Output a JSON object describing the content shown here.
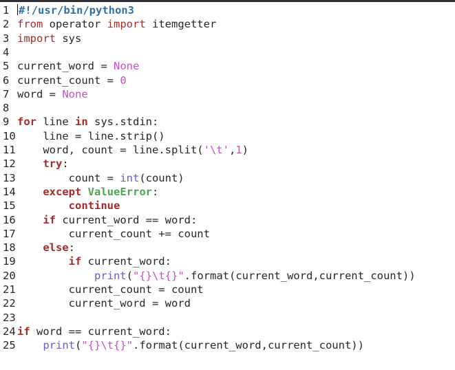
{
  "editor": {
    "language": "python",
    "colors": {
      "background": "#ffffff",
      "text": "#262626",
      "keyword": "#a52a2a",
      "builtin": "#6a5acd",
      "string": "#c451c4",
      "exception": "#4fa44f",
      "shebang": "#2f6fa8"
    },
    "lines": [
      {
        "n": "1",
        "tokens": [
          {
            "t": "#!/usr/bin/python3",
            "c": "sheb"
          }
        ]
      },
      {
        "n": "2",
        "tokens": [
          {
            "t": "from",
            "c": "kw2"
          },
          {
            "t": " operator ",
            "c": ""
          },
          {
            "t": "import",
            "c": "kw2"
          },
          {
            "t": " itemgetter",
            "c": ""
          }
        ]
      },
      {
        "n": "3",
        "tokens": [
          {
            "t": "import",
            "c": "kw2"
          },
          {
            "t": " sys",
            "c": ""
          }
        ]
      },
      {
        "n": "4",
        "tokens": []
      },
      {
        "n": "5",
        "tokens": [
          {
            "t": "current_word = ",
            "c": ""
          },
          {
            "t": "None",
            "c": "const"
          }
        ]
      },
      {
        "n": "6",
        "tokens": [
          {
            "t": "current_count = ",
            "c": ""
          },
          {
            "t": "0",
            "c": "const"
          }
        ]
      },
      {
        "n": "7",
        "tokens": [
          {
            "t": "word = ",
            "c": ""
          },
          {
            "t": "None",
            "c": "const"
          }
        ]
      },
      {
        "n": "8",
        "tokens": []
      },
      {
        "n": "9",
        "tokens": [
          {
            "t": "for",
            "c": "kw"
          },
          {
            "t": " line ",
            "c": ""
          },
          {
            "t": "in",
            "c": "kw"
          },
          {
            "t": " sys.stdin:",
            "c": ""
          }
        ]
      },
      {
        "n": "10",
        "tokens": [
          {
            "t": "    line = line.strip()",
            "c": ""
          }
        ]
      },
      {
        "n": "11",
        "tokens": [
          {
            "t": "    word, count = line.split(",
            "c": ""
          },
          {
            "t": "'\\t'",
            "c": "str"
          },
          {
            "t": ",",
            "c": ""
          },
          {
            "t": "1",
            "c": "const"
          },
          {
            "t": ")",
            "c": ""
          }
        ]
      },
      {
        "n": "12",
        "tokens": [
          {
            "t": "    ",
            "c": ""
          },
          {
            "t": "try",
            "c": "kw"
          },
          {
            "t": ":",
            "c": ""
          }
        ]
      },
      {
        "n": "13",
        "tokens": [
          {
            "t": "        count = ",
            "c": ""
          },
          {
            "t": "int",
            "c": "fn"
          },
          {
            "t": "(count)",
            "c": ""
          }
        ]
      },
      {
        "n": "14",
        "tokens": [
          {
            "t": "    ",
            "c": ""
          },
          {
            "t": "except",
            "c": "kw"
          },
          {
            "t": " ",
            "c": ""
          },
          {
            "t": "ValueError",
            "c": "exc"
          },
          {
            "t": ":",
            "c": ""
          }
        ]
      },
      {
        "n": "15",
        "tokens": [
          {
            "t": "        ",
            "c": ""
          },
          {
            "t": "continue",
            "c": "kw"
          }
        ]
      },
      {
        "n": "16",
        "tokens": [
          {
            "t": "    ",
            "c": ""
          },
          {
            "t": "if",
            "c": "kw"
          },
          {
            "t": " current_word == word:",
            "c": ""
          }
        ]
      },
      {
        "n": "17",
        "tokens": [
          {
            "t": "        current_count += count",
            "c": ""
          }
        ]
      },
      {
        "n": "18",
        "tokens": [
          {
            "t": "    ",
            "c": ""
          },
          {
            "t": "else",
            "c": "kw"
          },
          {
            "t": ":",
            "c": ""
          }
        ]
      },
      {
        "n": "19",
        "tokens": [
          {
            "t": "        ",
            "c": ""
          },
          {
            "t": "if",
            "c": "kw"
          },
          {
            "t": " current_word:",
            "c": ""
          }
        ]
      },
      {
        "n": "20",
        "tokens": [
          {
            "t": "            ",
            "c": ""
          },
          {
            "t": "print",
            "c": "fn"
          },
          {
            "t": "(",
            "c": ""
          },
          {
            "t": "\"{}\\t{}\"",
            "c": "str"
          },
          {
            "t": ".format(current_word,current_count))",
            "c": ""
          }
        ]
      },
      {
        "n": "21",
        "tokens": [
          {
            "t": "        current_count = count",
            "c": ""
          }
        ]
      },
      {
        "n": "22",
        "tokens": [
          {
            "t": "        current_word = word",
            "c": ""
          }
        ]
      },
      {
        "n": "23",
        "tokens": []
      },
      {
        "n": "24",
        "tokens": [
          {
            "t": "if",
            "c": "kw"
          },
          {
            "t": " word == current_word:",
            "c": ""
          }
        ]
      },
      {
        "n": "25",
        "tokens": [
          {
            "t": "    ",
            "c": ""
          },
          {
            "t": "print",
            "c": "fn"
          },
          {
            "t": "(",
            "c": ""
          },
          {
            "t": "\"{}\\t{}\"",
            "c": "str"
          },
          {
            "t": ".format(current_word,current_count))",
            "c": ""
          }
        ]
      }
    ]
  }
}
